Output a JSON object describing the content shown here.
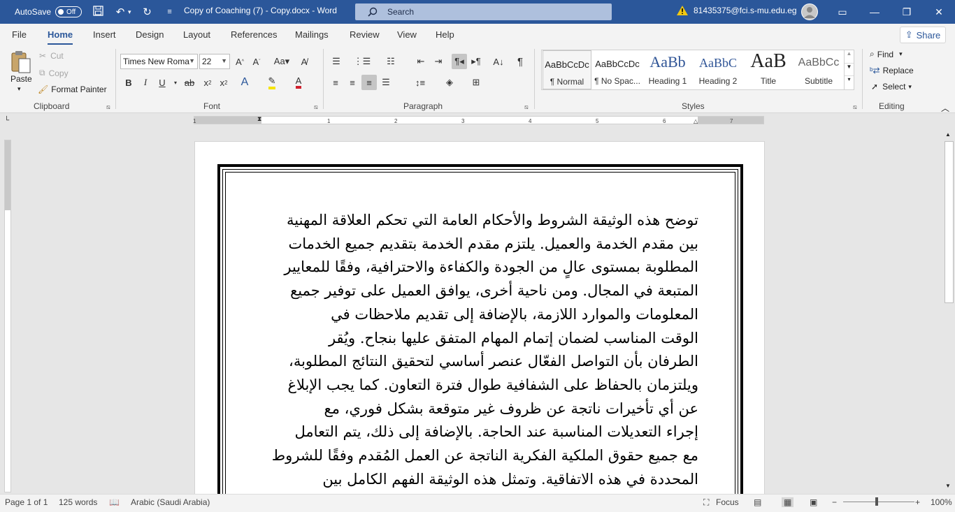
{
  "titlebar": {
    "autosave_label": "AutoSave",
    "autosave_state": "Off",
    "document_title": "Copy of Coaching (7) - Copy.docx  -  Word",
    "search_placeholder": "Search",
    "account": "81435375@fci.s-mu.edu.eg"
  },
  "menu": {
    "tabs": [
      "File",
      "Home",
      "Insert",
      "Design",
      "Layout",
      "References",
      "Mailings",
      "Review",
      "View",
      "Help"
    ],
    "active": "Home",
    "share_label": "Share"
  },
  "ribbon": {
    "clipboard": {
      "paste": "Paste",
      "cut": "Cut",
      "copy": "Copy",
      "format_painter": "Format Painter",
      "label": "Clipboard"
    },
    "font": {
      "name": "Times New Roma",
      "size": "22",
      "label": "Font"
    },
    "paragraph": {
      "label": "Paragraph"
    },
    "styles": {
      "label": "Styles",
      "items": [
        {
          "preview": "AaBbCcDc",
          "name": "¶ Normal"
        },
        {
          "preview": "AaBbCcDc",
          "name": "¶ No Spac..."
        },
        {
          "preview": "AaBb",
          "name": "Heading 1"
        },
        {
          "preview": "AaBbC",
          "name": "Heading 2"
        },
        {
          "preview": "AaB",
          "name": "Title"
        },
        {
          "preview": "AaBbCc",
          "name": "Subtitle"
        }
      ]
    },
    "editing": {
      "find": "Find",
      "replace": "Replace",
      "select": "Select",
      "label": "Editing"
    }
  },
  "ruler": {
    "ticks": [
      "1",
      "1",
      "2",
      "3",
      "4",
      "5",
      "6",
      "7"
    ]
  },
  "document": {
    "lines": [
      "توضح هذه الوثيقة الشروط والأحكام العامة التي تحكم العلاقة المهنية",
      "بين مقدم الخدمة والعميل. يلتزم مقدم الخدمة بتقديم جميع الخدمات",
      "المطلوبة بمستوى عالٍ من الجودة والكفاءة والاحترافية، وفقًا للمعايير",
      "المتبعة في المجال. ومن ناحية أخرى، يوافق العميل على توفير جميع",
      "المعلومات والموارد اللازمة، بالإضافة إلى تقديم ملاحظات في",
      "الوقت المناسب لضمان إتمام المهام المتفق عليها بنجاح. ويُقر",
      "الطرفان بأن التواصل الفعّال عنصر أساسي لتحقيق النتائج المطلوبة،",
      "ويلتزمان بالحفاظ على الشفافية طوال فترة التعاون. كما يجب الإبلاغ",
      "عن أي تأخيرات ناتجة عن ظروف غير متوقعة بشكل فوري، مع",
      "إجراء التعديلات المناسبة عند الحاجة. بالإضافة إلى ذلك، يتم التعامل",
      "مع جميع حقوق الملكية الفكرية الناتجة عن العمل المُقدم وفقًا للشروط",
      "المحددة في هذه الاتفاقية. وتمثل هذه الوثيقة الفهم الكامل بين"
    ]
  },
  "status": {
    "page": "Page 1 of 1",
    "words": "125 words",
    "language": "Arabic (Saudi Arabia)",
    "focus": "Focus",
    "zoom": "100%"
  }
}
